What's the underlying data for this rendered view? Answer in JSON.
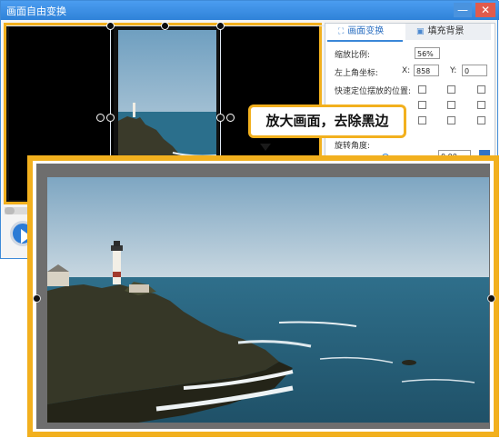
{
  "window": {
    "title": "画面自由变换",
    "min_label": "—",
    "close_label": "✕"
  },
  "tabs": [
    {
      "label": "画面变换",
      "icon": "transform-icon"
    },
    {
      "label": "填充背景",
      "icon": "fill-icon"
    }
  ],
  "form": {
    "scale_label": "缩放比例:",
    "scale_value": "56%",
    "topleft_label": "左上角坐标:",
    "x_label": "X:",
    "x_value": "858",
    "y_label": "Y:",
    "y_value": "0",
    "quickpos_label": "快速定位摆放的位置:",
    "rotate_label": "旋转角度:",
    "rotate_value": "0.00"
  },
  "callout": {
    "text": "放大画面，去除黑边"
  },
  "colors": {
    "accent": "#f2b01e",
    "brand": "#2f82d8"
  }
}
